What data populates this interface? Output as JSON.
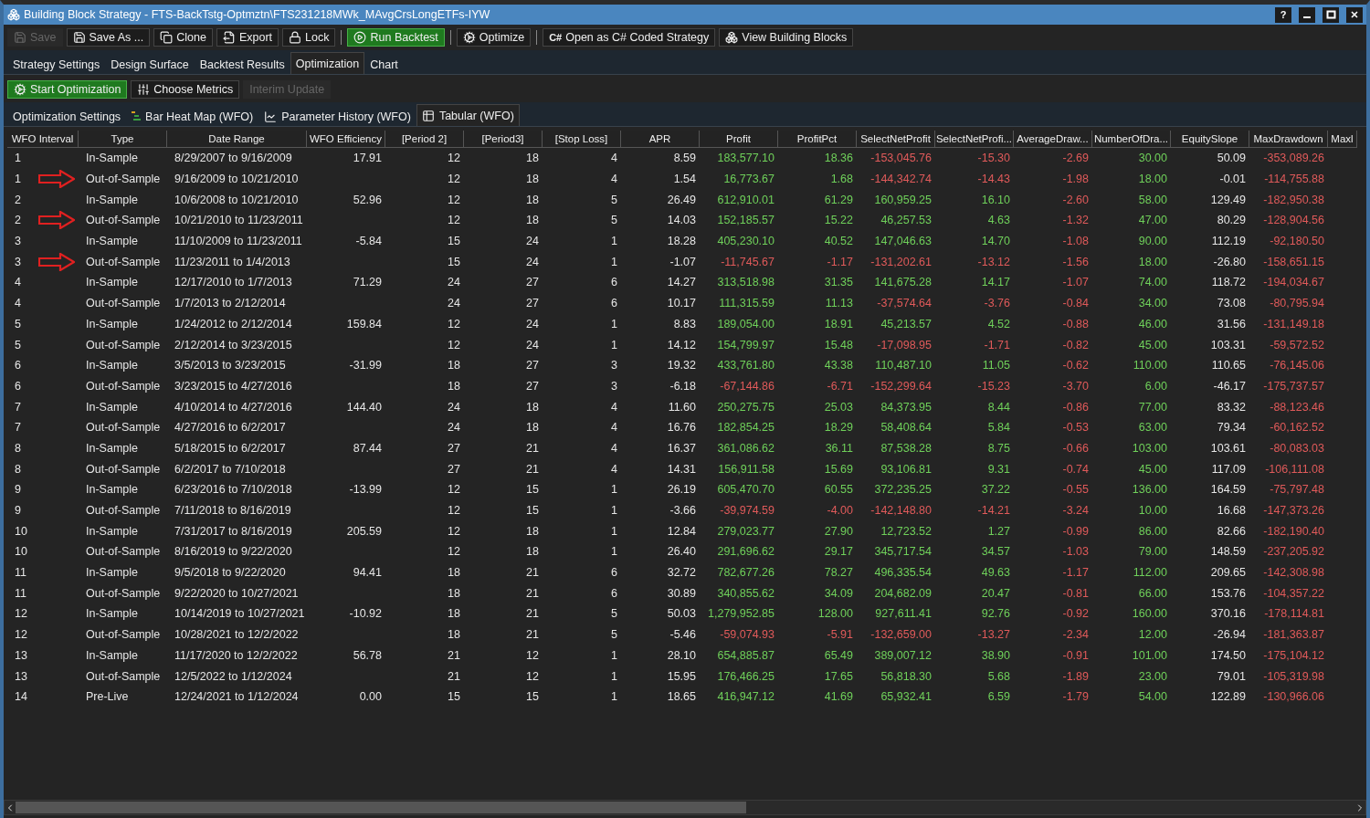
{
  "window": {
    "title": "Building Block Strategy - FTS-BackTstg-Optmztn\\FTS231218MWk_MAvgCrsLongETFs-IYW",
    "help": "?"
  },
  "toolbar": [
    {
      "label": "Save",
      "kind": "disabled"
    },
    {
      "label": "Save As ...",
      "kind": "normal"
    },
    {
      "label": "Clone",
      "kind": "normal"
    },
    {
      "label": "Export",
      "kind": "normal"
    },
    {
      "label": "Lock",
      "kind": "normal"
    },
    {
      "label": "Run Backtest",
      "kind": "primary"
    },
    {
      "label": "Optimize",
      "kind": "normal"
    },
    {
      "label": "Open as C# Coded Strategy",
      "icon_text": "C#",
      "kind": "normal"
    },
    {
      "label": "View Building Blocks",
      "kind": "normal"
    }
  ],
  "tabs": [
    {
      "label": "Strategy Settings",
      "selected": false
    },
    {
      "label": "Design Surface",
      "selected": false
    },
    {
      "label": "Backtest Results",
      "selected": false
    },
    {
      "label": "Optimization",
      "selected": true
    },
    {
      "label": "Chart",
      "selected": false
    }
  ],
  "optimization_toolbar": [
    {
      "label": "Start Optimization",
      "kind": "primary"
    },
    {
      "label": "Choose Metrics",
      "kind": "normal"
    },
    {
      "label": "Interim Update",
      "kind": "disabled"
    }
  ],
  "sub_tabs": [
    {
      "label": "Optimization Settings",
      "selected": false
    },
    {
      "label": "Bar Heat Map (WFO)",
      "selected": false
    },
    {
      "label": "Parameter History (WFO)",
      "selected": false
    },
    {
      "label": "Tabular (WFO)",
      "selected": true
    }
  ],
  "table": {
    "columns": [
      {
        "label": "WFO Interval",
        "kind": "index"
      },
      {
        "label": "Type",
        "kind": "text"
      },
      {
        "label": "Date Range",
        "kind": "text"
      },
      {
        "label": "WFO Efficiency",
        "kind": "plain"
      },
      {
        "label": "[Period 2]",
        "kind": "plain"
      },
      {
        "label": "[Period3]",
        "kind": "plain"
      },
      {
        "label": "[Stop Loss]",
        "kind": "plain"
      },
      {
        "label": "APR",
        "kind": "plain"
      },
      {
        "label": "Profit",
        "kind": "signed"
      },
      {
        "label": "ProfitPct",
        "kind": "signed"
      },
      {
        "label": "SelectNetProfit",
        "kind": "signed"
      },
      {
        "label": "SelectNetProfi...",
        "kind": "signed"
      },
      {
        "label": "AverageDraw...",
        "kind": "signed"
      },
      {
        "label": "NumberOfDra...",
        "kind": "signed"
      },
      {
        "label": "EquitySlope",
        "kind": "plain"
      },
      {
        "label": "MaxDrawdown",
        "kind": "signed"
      },
      {
        "label": "Maxl"
      }
    ],
    "rows": [
      {
        "marked": false,
        "cells": [
          "1",
          "In-Sample",
          "8/29/2007 to 9/16/2009",
          "17.91",
          "12",
          "18",
          "4",
          "8.59",
          "183,577.10",
          "18.36",
          "-153,045.76",
          "-15.30",
          "-2.69",
          "30.00",
          "50.09",
          "-353,089.26"
        ]
      },
      {
        "marked": true,
        "cells": [
          "1",
          "Out-of-Sample",
          "9/16/2009 to 10/21/2010",
          null,
          "12",
          "18",
          "4",
          "1.54",
          "16,773.67",
          "1.68",
          "-144,342.74",
          "-14.43",
          "-1.98",
          "18.00",
          "-0.01",
          "-114,755.88"
        ]
      },
      {
        "marked": false,
        "cells": [
          "2",
          "In-Sample",
          "10/6/2008 to 10/21/2010",
          "52.96",
          "12",
          "18",
          "5",
          "26.49",
          "612,910.01",
          "61.29",
          "160,959.25",
          "16.10",
          "-2.60",
          "58.00",
          "129.49",
          "-182,950.38"
        ]
      },
      {
        "marked": true,
        "cells": [
          "2",
          "Out-of-Sample",
          "10/21/2010 to 11/23/2011",
          null,
          "12",
          "18",
          "5",
          "14.03",
          "152,185.57",
          "15.22",
          "46,257.53",
          "4.63",
          "-1.32",
          "47.00",
          "80.29",
          "-128,904.56"
        ]
      },
      {
        "marked": false,
        "cells": [
          "3",
          "In-Sample",
          "11/10/2009 to 11/23/2011",
          "-5.84",
          "15",
          "24",
          "1",
          "18.28",
          "405,230.10",
          "40.52",
          "147,046.63",
          "14.70",
          "-1.08",
          "90.00",
          "112.19",
          "-92,180.50"
        ]
      },
      {
        "marked": true,
        "cells": [
          "3",
          "Out-of-Sample",
          "11/23/2011 to 1/4/2013",
          null,
          "15",
          "24",
          "1",
          "-1.07",
          "-11,745.67",
          "-1.17",
          "-131,202.61",
          "-13.12",
          "-1.56",
          "18.00",
          "-26.80",
          "-158,651.15"
        ]
      },
      {
        "marked": false,
        "cells": [
          "4",
          "In-Sample",
          "12/17/2010 to 1/7/2013",
          "71.29",
          "24",
          "27",
          "6",
          "14.27",
          "313,518.98",
          "31.35",
          "141,675.28",
          "14.17",
          "-1.07",
          "74.00",
          "118.72",
          "-194,034.67"
        ]
      },
      {
        "marked": false,
        "cells": [
          "4",
          "Out-of-Sample",
          "1/7/2013 to 2/12/2014",
          null,
          "24",
          "27",
          "6",
          "10.17",
          "111,315.59",
          "11.13",
          "-37,574.64",
          "-3.76",
          "-0.84",
          "34.00",
          "73.08",
          "-80,795.94"
        ]
      },
      {
        "marked": false,
        "cells": [
          "5",
          "In-Sample",
          "1/24/2012 to 2/12/2014",
          "159.84",
          "12",
          "24",
          "1",
          "8.83",
          "189,054.00",
          "18.91",
          "45,213.57",
          "4.52",
          "-0.88",
          "46.00",
          "31.56",
          "-131,149.18"
        ]
      },
      {
        "marked": false,
        "cells": [
          "5",
          "Out-of-Sample",
          "2/12/2014 to 3/23/2015",
          null,
          "12",
          "24",
          "1",
          "14.12",
          "154,799.97",
          "15.48",
          "-17,098.95",
          "-1.71",
          "-0.82",
          "45.00",
          "103.31",
          "-59,572.52"
        ]
      },
      {
        "marked": false,
        "cells": [
          "6",
          "In-Sample",
          "3/5/2013 to 3/23/2015",
          "-31.99",
          "18",
          "27",
          "3",
          "19.32",
          "433,761.80",
          "43.38",
          "110,487.10",
          "11.05",
          "-0.62",
          "110.00",
          "110.65",
          "-76,145.06"
        ]
      },
      {
        "marked": false,
        "cells": [
          "6",
          "Out-of-Sample",
          "3/23/2015 to 4/27/2016",
          null,
          "18",
          "27",
          "3",
          "-6.18",
          "-67,144.86",
          "-6.71",
          "-152,299.64",
          "-15.23",
          "-3.70",
          "6.00",
          "-46.17",
          "-175,737.57"
        ]
      },
      {
        "marked": false,
        "cells": [
          "7",
          "In-Sample",
          "4/10/2014 to 4/27/2016",
          "144.40",
          "24",
          "18",
          "4",
          "11.60",
          "250,275.75",
          "25.03",
          "84,373.95",
          "8.44",
          "-0.86",
          "77.00",
          "83.32",
          "-88,123.46"
        ]
      },
      {
        "marked": false,
        "cells": [
          "7",
          "Out-of-Sample",
          "4/27/2016 to 6/2/2017",
          null,
          "24",
          "18",
          "4",
          "16.76",
          "182,854.25",
          "18.29",
          "58,408.64",
          "5.84",
          "-0.53",
          "63.00",
          "79.34",
          "-60,162.52"
        ]
      },
      {
        "marked": false,
        "cells": [
          "8",
          "In-Sample",
          "5/18/2015 to 6/2/2017",
          "87.44",
          "27",
          "21",
          "4",
          "16.37",
          "361,086.62",
          "36.11",
          "87,538.28",
          "8.75",
          "-0.66",
          "103.00",
          "103.61",
          "-80,083.03"
        ]
      },
      {
        "marked": false,
        "cells": [
          "8",
          "Out-of-Sample",
          "6/2/2017 to 7/10/2018",
          null,
          "27",
          "21",
          "4",
          "14.31",
          "156,911.58",
          "15.69",
          "93,106.81",
          "9.31",
          "-0.74",
          "45.00",
          "117.09",
          "-106,111.08"
        ]
      },
      {
        "marked": false,
        "cells": [
          "9",
          "In-Sample",
          "6/23/2016 to 7/10/2018",
          "-13.99",
          "12",
          "15",
          "1",
          "26.19",
          "605,470.70",
          "60.55",
          "372,235.25",
          "37.22",
          "-0.55",
          "136.00",
          "164.59",
          "-75,797.48"
        ]
      },
      {
        "marked": false,
        "cells": [
          "9",
          "Out-of-Sample",
          "7/11/2018 to 8/16/2019",
          null,
          "12",
          "15",
          "1",
          "-3.66",
          "-39,974.59",
          "-4.00",
          "-142,148.80",
          "-14.21",
          "-3.24",
          "10.00",
          "16.68",
          "-147,373.26"
        ]
      },
      {
        "marked": false,
        "cells": [
          "10",
          "In-Sample",
          "7/31/2017 to 8/16/2019",
          "205.59",
          "12",
          "18",
          "1",
          "12.84",
          "279,023.77",
          "27.90",
          "12,723.52",
          "1.27",
          "-0.99",
          "86.00",
          "82.66",
          "-182,190.40"
        ]
      },
      {
        "marked": false,
        "cells": [
          "10",
          "Out-of-Sample",
          "8/16/2019 to 9/22/2020",
          null,
          "12",
          "18",
          "1",
          "26.40",
          "291,696.62",
          "29.17",
          "345,717.54",
          "34.57",
          "-1.03",
          "79.00",
          "148.59",
          "-237,205.92"
        ]
      },
      {
        "marked": false,
        "cells": [
          "11",
          "In-Sample",
          "9/5/2018 to 9/22/2020",
          "94.41",
          "18",
          "21",
          "6",
          "32.72",
          "782,677.26",
          "78.27",
          "496,335.54",
          "49.63",
          "-1.17",
          "112.00",
          "209.65",
          "-142,308.98"
        ]
      },
      {
        "marked": false,
        "cells": [
          "11",
          "Out-of-Sample",
          "9/22/2020 to 10/27/2021",
          null,
          "18",
          "21",
          "6",
          "30.89",
          "340,855.62",
          "34.09",
          "204,682.09",
          "20.47",
          "-0.81",
          "66.00",
          "153.76",
          "-104,357.22"
        ]
      },
      {
        "marked": false,
        "cells": [
          "12",
          "In-Sample",
          "10/14/2019 to 10/27/2021",
          "-10.92",
          "18",
          "21",
          "5",
          "50.03",
          "1,279,952.85",
          "128.00",
          "927,611.41",
          "92.76",
          "-0.92",
          "160.00",
          "370.16",
          "-178,114.81"
        ]
      },
      {
        "marked": false,
        "cells": [
          "12",
          "Out-of-Sample",
          "10/28/2021 to 12/2/2022",
          null,
          "18",
          "21",
          "5",
          "-5.46",
          "-59,074.93",
          "-5.91",
          "-132,659.00",
          "-13.27",
          "-2.34",
          "12.00",
          "-26.94",
          "-181,363.87"
        ]
      },
      {
        "marked": false,
        "cells": [
          "13",
          "In-Sample",
          "11/17/2020 to 12/2/2022",
          "56.78",
          "21",
          "12",
          "1",
          "28.10",
          "654,885.87",
          "65.49",
          "389,007.12",
          "38.90",
          "-0.91",
          "101.00",
          "174.50",
          "-175,104.12"
        ]
      },
      {
        "marked": false,
        "cells": [
          "13",
          "Out-of-Sample",
          "12/5/2022 to 1/12/2024",
          null,
          "21",
          "12",
          "1",
          "15.95",
          "176,466.25",
          "17.65",
          "56,818.30",
          "5.68",
          "-1.89",
          "23.00",
          "79.01",
          "-105,319.98"
        ]
      },
      {
        "marked": false,
        "cells": [
          "14",
          "Pre-Live",
          "12/24/2021 to 1/12/2024",
          "0.00",
          "15",
          "15",
          "1",
          "18.65",
          "416,947.12",
          "41.69",
          "65,932.41",
          "6.59",
          "-1.79",
          "54.00",
          "122.89",
          "-130,966.06"
        ]
      }
    ]
  }
}
